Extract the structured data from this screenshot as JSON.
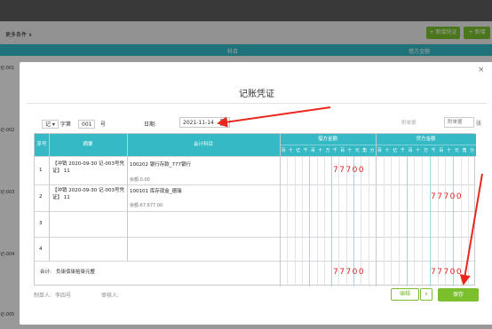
{
  "background": {
    "filter_label": "更多条件 ∨",
    "new_button": "+ 新增凭证",
    "new_button2": "+ 新增",
    "col_headers": [
      "科目",
      "借方金额"
    ],
    "row_prefixes": [
      "记-001",
      "记-002",
      "记-003",
      "记-004",
      "记-005"
    ]
  },
  "modal": {
    "title": "记账凭证",
    "close": "×",
    "voucher_word": "记 ▾",
    "seq_label": "字第",
    "seq_value": "001",
    "seq_suffix": "号",
    "date_label": "日期:",
    "date_value": "2021-11-14",
    "attach_label": "附单据",
    "attach_placeholder": "附单据",
    "attach_unit": "张"
  },
  "table": {
    "headers": {
      "seq": "序号",
      "summary": "摘要",
      "subject": "会计科目",
      "debit": "借方金额",
      "credit": "贷方金额"
    },
    "digits": [
      "百",
      "十",
      "亿",
      "千",
      "百",
      "十",
      "万",
      "千",
      "百",
      "十",
      "元",
      "角",
      "分"
    ],
    "rows": [
      {
        "no": "1",
        "summary": "【冲销 2020-09-30 记-003号凭证】 11",
        "subject": "100202 银行存款_777银行",
        "balance": "余额:0.00",
        "debit": "77700",
        "credit": ""
      },
      {
        "no": "2",
        "summary": "【冲销 2020-09-30 记-003号凭证】 11",
        "subject": "100101 库存现金_德瑞",
        "balance": "余额:67,677.00",
        "debit": "",
        "credit": "77700"
      },
      {
        "no": "3",
        "summary": "",
        "subject": "",
        "balance": "",
        "debit": "",
        "credit": ""
      },
      {
        "no": "4",
        "summary": "",
        "subject": "",
        "balance": "",
        "debit": "",
        "credit": ""
      }
    ],
    "total_label": "合计:",
    "total_words": "负柒佰柒拾柒元整",
    "total_debit": "77700",
    "total_credit": "77700"
  },
  "footer": {
    "maker_label": "制单人:",
    "maker_value": "李四号",
    "auditor_label": "审核人:",
    "edit_button": "编辑",
    "more_button": "∨",
    "save_button": "保存"
  },
  "colors": {
    "accent": "#35b9c5",
    "primary_btn": "#7bbf2e",
    "amount": "#e02020",
    "annotation": "#e8281e"
  }
}
